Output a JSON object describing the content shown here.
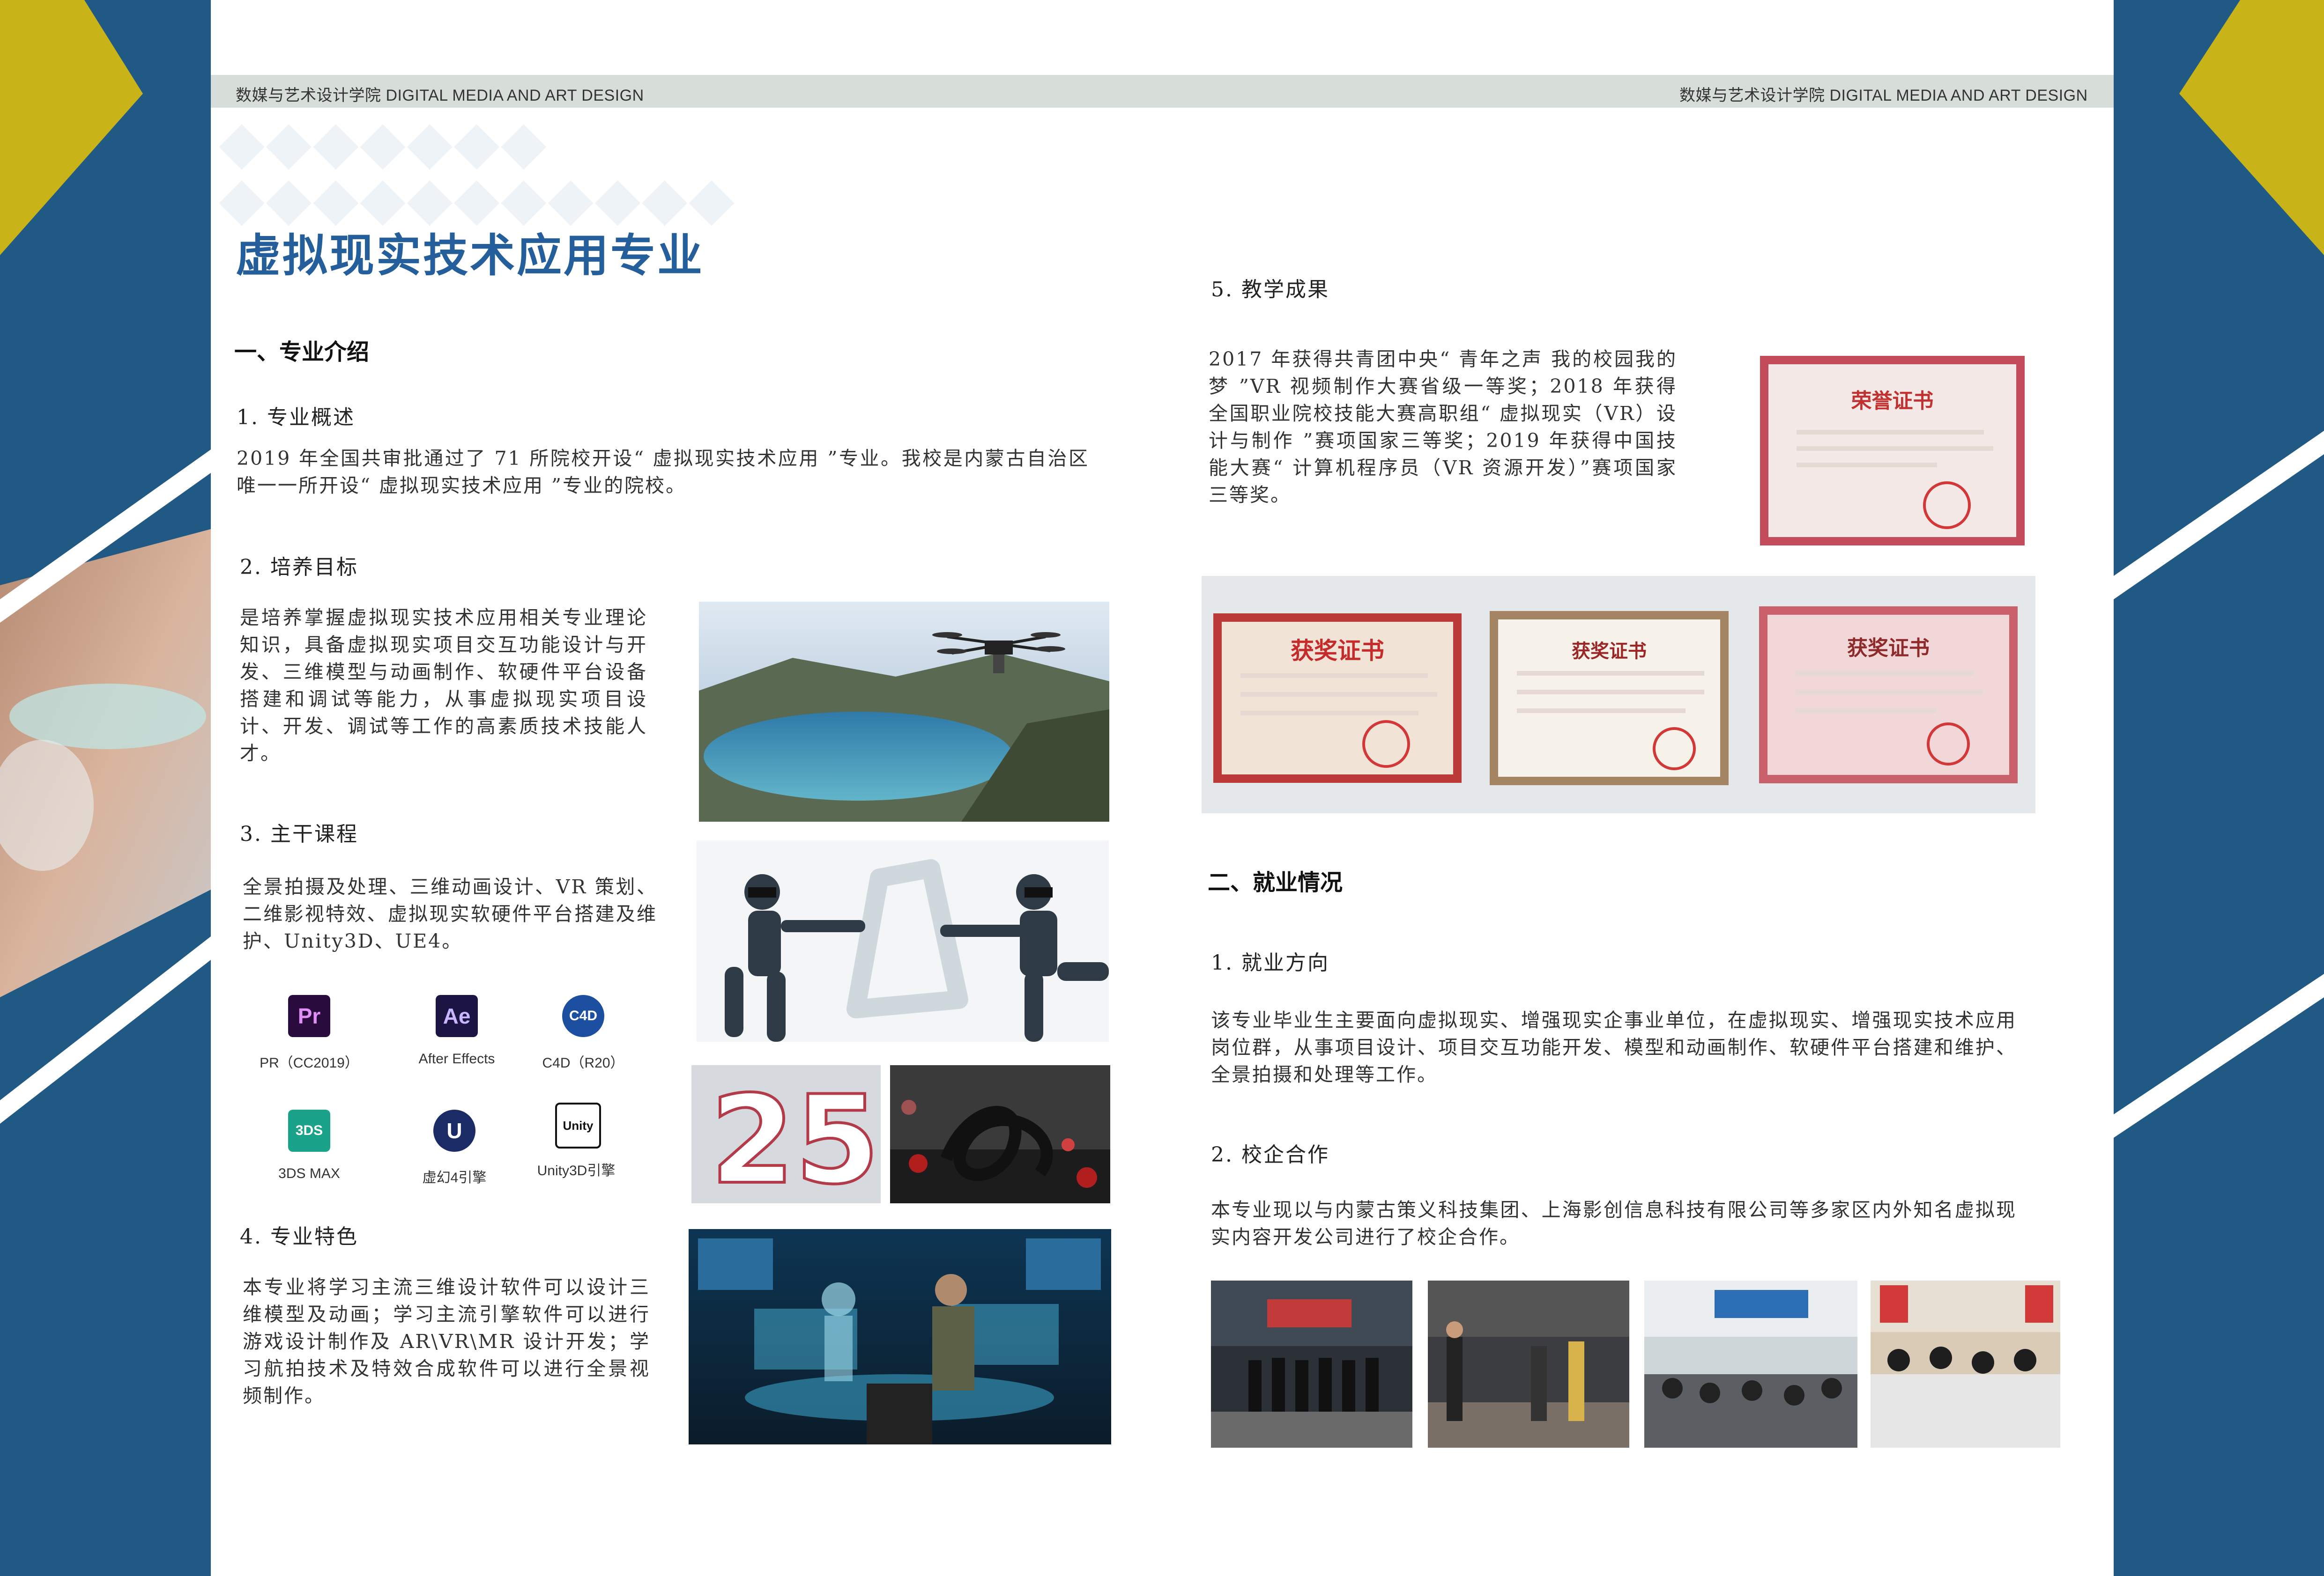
{
  "header": {
    "left_text": "数媒与艺术设计学院 DIGITAL MEDIA AND ART DESIGN",
    "right_text": "数媒与艺术设计学院 DIGITAL MEDIA AND ART DESIGN"
  },
  "title": "虚拟现实技术应用专业",
  "section1": {
    "heading": "一、专业介绍",
    "overview": {
      "heading": "1. 专业概述",
      "text": "2019 年全国共审批通过了 71 所院校开设“ 虚拟现实技术应用 ”专业。我校是内蒙古自治区唯一一所开设“ 虚拟现实技术应用 ”专业的院校。"
    },
    "goal": {
      "heading": "2. 培养目标",
      "text": "是培养掌握虚拟现实技术应用相关专业理论知识，具备虚拟现实项目交互功能设计与开发、三维模型与动画制作、软硬件平台设备搭建和调试等能力，从事虚拟现实项目设计、开发、调试等工作的高素质技术技能人才。"
    },
    "courses": {
      "heading": "3. 主干课程",
      "text": "全景拍摄及处理、三维动画设计、VR 策划、二维影视特效、虚拟现实软硬件平台搭建及维护、Unity3D、UE4。"
    },
    "software": [
      {
        "icon": "Pr",
        "label": "PR（CC2019）"
      },
      {
        "icon": "Ae",
        "label": "After Effects"
      },
      {
        "icon": "C4D",
        "label": "C4D（R20）"
      },
      {
        "icon": "3DS",
        "label": "3DS MAX"
      },
      {
        "icon": "U",
        "label": "虚幻4引擎"
      },
      {
        "icon": "Unity",
        "label": "Unity3D引擎"
      }
    ],
    "features": {
      "heading": "4. 专业特色",
      "text": "本专业将学习主流三维设计软件可以设计三维模型及动画；学习主流引擎软件可以进行游戏设计制作及 AR\\VR\\MR 设计开发；学习航拍技术及特效合成软件可以进行全景视频制作。"
    },
    "results": {
      "heading": "5. 教学成果",
      "text": "2017 年获得共青团中央“ 青年之声 我的校园我的梦 ”VR 视频制作大赛省级一等奖；2018 年获得全国职业院校技能大赛高职组“ 虚拟现实（VR）设计与制作 ”赛项国家三等奖；2019 年获得中国技能大赛“ 计算机程序员（VR 资源开发）”赛项国家三等奖。"
    },
    "certificates": [
      {
        "title": "荣誉证书"
      },
      {
        "title": "获奖证书"
      },
      {
        "title": "获奖证书"
      },
      {
        "title": "获奖证书"
      }
    ]
  },
  "section2": {
    "heading": "二、就业情况",
    "direction": {
      "heading": "1. 就业方向",
      "text": "该专业毕业生主要面向虚拟现实、增强现实企事业单位，在虚拟现实、增强现实技术应用岗位群，从事项目设计、项目交互功能开发、模型和动画制作、软硬件平台搭建和维护、全景拍摄和处理等工作。"
    },
    "cooperation": {
      "heading": "2. 校企合作",
      "text": "本专业现以与内蒙古策义科技集团、上海影创信息科技有限公司等多家区内外知名虚拟现实内容开发公司进行了校企合作。"
    }
  },
  "colors": {
    "side_blue": "#205a84",
    "accent_gold": "#c8b318",
    "title_blue": "#245f9b",
    "header_band": "#d7ddd9"
  }
}
